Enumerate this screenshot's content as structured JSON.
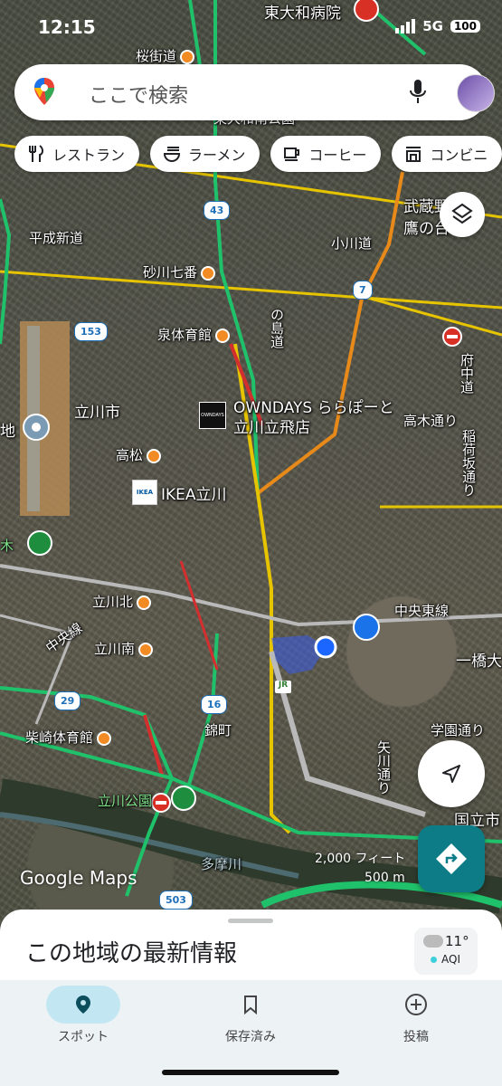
{
  "status_bar": {
    "time": "12:15",
    "network": "5G",
    "battery": "100"
  },
  "search": {
    "placeholder": "ここで検索"
  },
  "chips": [
    {
      "label": "レストラン",
      "icon": "restaurant-icon"
    },
    {
      "label": "ラーメン",
      "icon": "ramen-icon"
    },
    {
      "label": "コーヒー",
      "icon": "coffee-icon"
    },
    {
      "label": "コンビニ",
      "icon": "store-icon"
    }
  ],
  "map": {
    "labels": {
      "hospital": "東大和病院",
      "sakurakaido": "桜街道",
      "higashiyamato_park": "東大和南公園",
      "heisei_shindo": "平成新道",
      "sunagawa": "砂川七番",
      "kodaira": "小川道",
      "musashi": "武蔵野",
      "takanodai": "鷹の台",
      "izumi": "泉体育館",
      "shimagi": "の島道",
      "fuchu": "府中道",
      "tachikawa_city": "立川市",
      "owndays_1": "OWNDAYS ららぽーと",
      "owndays_2": "立川立飛店",
      "takagi": "高木通り",
      "inaka": "稲荷坂通り",
      "takamatsu": "高松",
      "ikea": "IKEA立川",
      "chi": "地",
      "ki": "木",
      "tachikawa_kita": "立川北",
      "chuo_line": "中央線",
      "chuo_east": "中央東線",
      "tachikawa_minami": "立川南",
      "ichibashi": "一橋大",
      "shibasaki": "柴崎体育館",
      "nishikicho": "錦町",
      "gakuen": "学園通り",
      "yagawa": "矢川通り",
      "tachikawa_park": "立川公園",
      "kunitachi": "国立市",
      "tamagawa": "多摩川",
      "jr": "JR",
      "owndays_logo": "OWNDAYS",
      "ikea_logo": "IKEA"
    },
    "shields": [
      "43",
      "7",
      "153",
      "29",
      "16",
      "503"
    ],
    "attribution": "Google Maps",
    "scale_imperial": "2,000 フィート",
    "scale_metric": "500 m"
  },
  "bottom_sheet": {
    "title": "この地域の最新情報",
    "temperature": "11°",
    "aqi_label": "AQI"
  },
  "nav": [
    {
      "label": "スポット",
      "icon": "explore-pin-icon",
      "active": true
    },
    {
      "label": "保存済み",
      "icon": "bookmark-icon",
      "active": false
    },
    {
      "label": "投稿",
      "icon": "add-circle-icon",
      "active": false
    }
  ]
}
